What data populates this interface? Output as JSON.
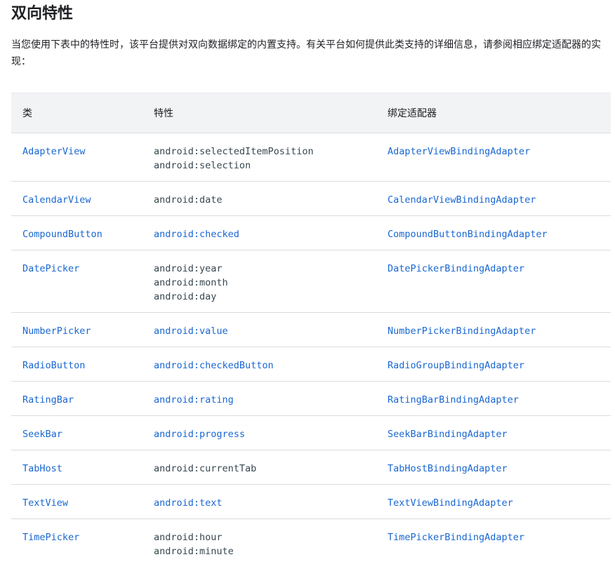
{
  "heading": "双向特性",
  "intro": "当您使用下表中的特性时，该平台提供对双向数据绑定的内置支持。有关平台如何提供此类支持的详细信息，请参阅相应绑定适配器的实现：",
  "table": {
    "headers": [
      "类",
      "特性",
      "绑定适配器"
    ],
    "rows": [
      {
        "class": "AdapterView",
        "attributes": [
          "android:selectedItemPosition",
          "android:selection"
        ],
        "attr_link": false,
        "adapter": "AdapterViewBindingAdapter"
      },
      {
        "class": "CalendarView",
        "attributes": [
          "android:date"
        ],
        "attr_link": false,
        "adapter": "CalendarViewBindingAdapter"
      },
      {
        "class": "CompoundButton",
        "attributes": [
          "android:checked"
        ],
        "attr_link": true,
        "adapter": "CompoundButtonBindingAdapter"
      },
      {
        "class": "DatePicker",
        "attributes": [
          "android:year",
          "android:month",
          "android:day"
        ],
        "attr_link": false,
        "adapter": "DatePickerBindingAdapter"
      },
      {
        "class": "NumberPicker",
        "attributes": [
          "android:value"
        ],
        "attr_link": true,
        "adapter": "NumberPickerBindingAdapter"
      },
      {
        "class": "RadioButton",
        "attributes": [
          "android:checkedButton"
        ],
        "attr_link": true,
        "adapter": "RadioGroupBindingAdapter"
      },
      {
        "class": "RatingBar",
        "attributes": [
          "android:rating"
        ],
        "attr_link": true,
        "adapter": "RatingBarBindingAdapter"
      },
      {
        "class": "SeekBar",
        "attributes": [
          "android:progress"
        ],
        "attr_link": true,
        "adapter": "SeekBarBindingAdapter"
      },
      {
        "class": "TabHost",
        "attributes": [
          "android:currentTab"
        ],
        "attr_link": false,
        "adapter": "TabHostBindingAdapter"
      },
      {
        "class": "TextView",
        "attributes": [
          "android:text"
        ],
        "attr_link": true,
        "adapter": "TextViewBindingAdapter"
      },
      {
        "class": "TimePicker",
        "attributes": [
          "android:hour",
          "android:minute"
        ],
        "attr_link": false,
        "adapter": "TimePickerBindingAdapter"
      }
    ]
  },
  "colors": {
    "link": "#1967d2",
    "code_text": "#37474f",
    "header_bg": "#f1f3f4",
    "row_border": "#dadce0"
  }
}
